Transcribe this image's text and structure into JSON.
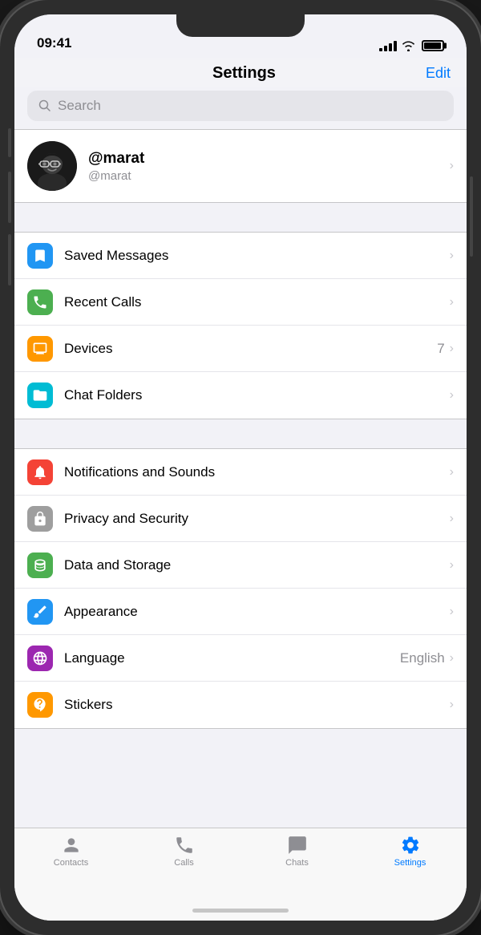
{
  "status": {
    "time": "09:41",
    "signal_bars": [
      4,
      7,
      10,
      13,
      16
    ],
    "battery_level": "full"
  },
  "header": {
    "title": "Settings",
    "edit_label": "Edit"
  },
  "search": {
    "placeholder": "Search"
  },
  "profile": {
    "name": "@marat",
    "handle": "@marat"
  },
  "sections": [
    {
      "id": "section1",
      "items": [
        {
          "id": "saved-messages",
          "label": "Saved Messages",
          "icon_color": "#2196f3",
          "icon_type": "bookmark",
          "badge": null
        },
        {
          "id": "recent-calls",
          "label": "Recent Calls",
          "icon_color": "#4caf50",
          "icon_type": "phone",
          "badge": null
        },
        {
          "id": "devices",
          "label": "Devices",
          "icon_color": "#ff9800",
          "icon_type": "monitor",
          "badge": "7"
        },
        {
          "id": "chat-folders",
          "label": "Chat Folders",
          "icon_color": "#00bcd4",
          "icon_type": "folder",
          "badge": null
        }
      ]
    },
    {
      "id": "section2",
      "items": [
        {
          "id": "notifications",
          "label": "Notifications and Sounds",
          "icon_color": "#f44336",
          "icon_type": "bell",
          "badge": null
        },
        {
          "id": "privacy",
          "label": "Privacy and Security",
          "icon_color": "#9e9e9e",
          "icon_type": "lock",
          "badge": null
        },
        {
          "id": "data-storage",
          "label": "Data and Storage",
          "icon_color": "#4caf50",
          "icon_type": "database",
          "badge": null
        },
        {
          "id": "appearance",
          "label": "Appearance",
          "icon_color": "#2196f3",
          "icon_type": "brush",
          "badge": null
        },
        {
          "id": "language",
          "label": "Language",
          "icon_color": "#9c27b0",
          "icon_type": "globe",
          "value": "English",
          "badge": null
        },
        {
          "id": "stickers",
          "label": "Stickers",
          "icon_color": "#ff9800",
          "icon_type": "sticker",
          "badge": null
        }
      ]
    }
  ],
  "tabs": [
    {
      "id": "contacts",
      "label": "Contacts",
      "icon": "person",
      "active": false
    },
    {
      "id": "calls",
      "label": "Calls",
      "icon": "phone-tab",
      "active": false
    },
    {
      "id": "chats",
      "label": "Chats",
      "icon": "chat",
      "active": false
    },
    {
      "id": "settings",
      "label": "Settings",
      "icon": "gear",
      "active": true
    }
  ]
}
